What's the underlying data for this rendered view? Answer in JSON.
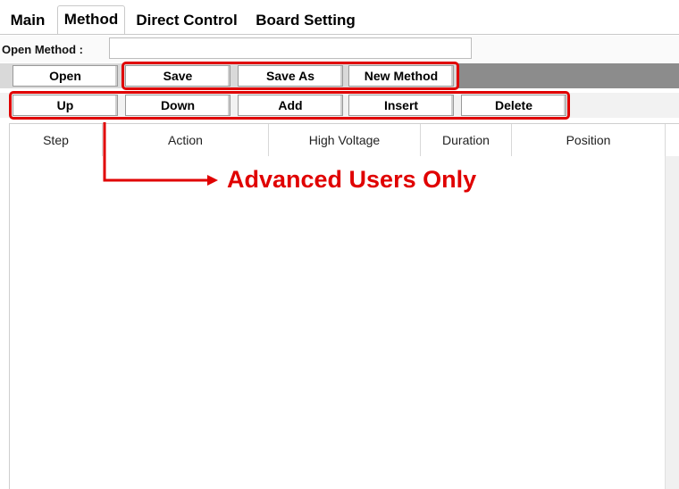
{
  "tabs": [
    {
      "label": "Main",
      "active": false
    },
    {
      "label": "Method",
      "active": true
    },
    {
      "label": "Direct Control",
      "active": false
    },
    {
      "label": "Board Setting",
      "active": false
    }
  ],
  "open_method": {
    "label": "Open Method :",
    "value": "",
    "placeholder": ""
  },
  "toolbar1": {
    "open_label": "Open",
    "save_label": "Save",
    "save_as_label": "Save As",
    "new_method_label": "New Method"
  },
  "toolbar2": {
    "up_label": "Up",
    "down_label": "Down",
    "add_label": "Add",
    "insert_label": "Insert",
    "delete_label": "Delete"
  },
  "table": {
    "columns": [
      "Step",
      "Action",
      "High Voltage",
      "Duration",
      "Position"
    ],
    "rows": []
  },
  "annotation": {
    "text": "Advanced Users Only",
    "color": "#e00000"
  }
}
